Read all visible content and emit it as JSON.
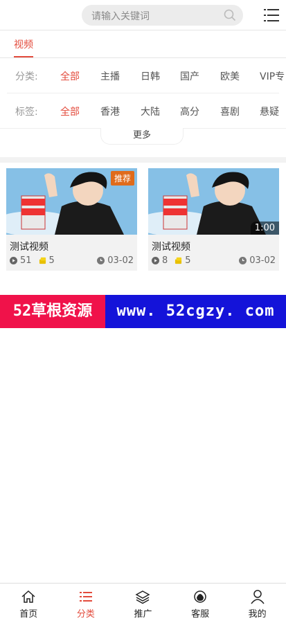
{
  "header": {
    "search_placeholder": "请输入关键词"
  },
  "tabs": {
    "active": "视频"
  },
  "filters": {
    "category": {
      "label": "分类:",
      "options": [
        "全部",
        "主播",
        "日韩",
        "国产",
        "欧美",
        "VIP专"
      ],
      "active_index": 0
    },
    "tag": {
      "label": "标签:",
      "options": [
        "全部",
        "香港",
        "大陆",
        "高分",
        "喜剧",
        "悬疑"
      ],
      "active_index": 0
    },
    "more_label": "更多"
  },
  "videos": [
    {
      "title": "测试视频",
      "plays": "51",
      "coins": "5",
      "date": "03-02",
      "badge": "推荐",
      "duration": ""
    },
    {
      "title": "测试视频",
      "plays": "8",
      "coins": "5",
      "date": "03-02",
      "badge": "",
      "duration": "1:00"
    }
  ],
  "banner": {
    "left_text": "52草根资源",
    "right_text": "www. 52cgzy. com"
  },
  "bottom_nav": {
    "items": [
      {
        "label": "首页",
        "icon": "home-icon"
      },
      {
        "label": "分类",
        "icon": "category-list-icon"
      },
      {
        "label": "推广",
        "icon": "layers-icon"
      },
      {
        "label": "客服",
        "icon": "headset-icon"
      },
      {
        "label": "我的",
        "icon": "user-icon"
      }
    ],
    "active_index": 1
  },
  "colors": {
    "accent": "#e34b3c",
    "badge": "#e06b1b",
    "banner_left": "#f0124a",
    "banner_right": "#1413d9"
  }
}
